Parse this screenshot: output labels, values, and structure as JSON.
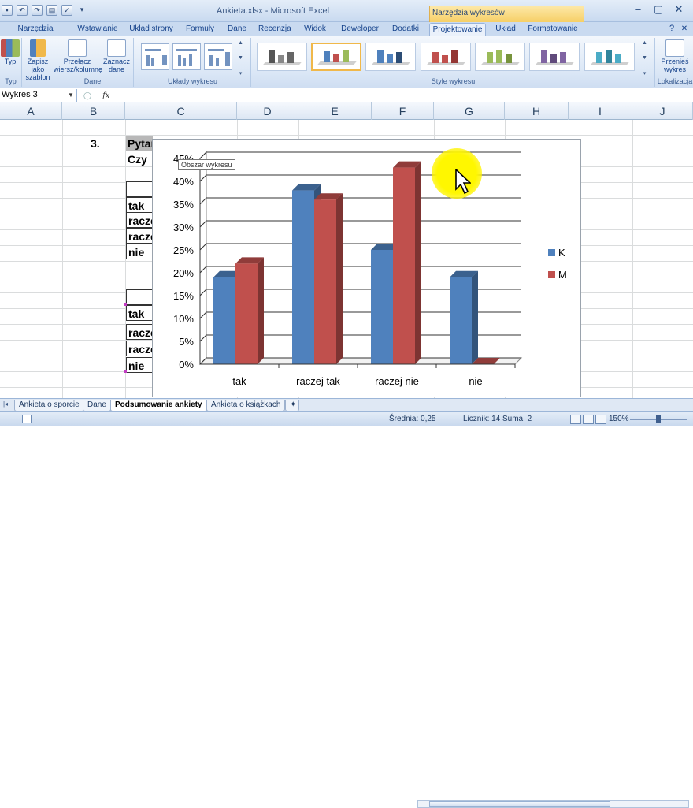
{
  "window": {
    "title": "Ankieta.xlsx - Microsoft Excel",
    "context_tools": "Narzędzia wykresów",
    "controls": [
      "–",
      "▢",
      "✕"
    ]
  },
  "ribbon_tabs": [
    "Narzędzia główne",
    "Wstawianie",
    "Układ strony",
    "Formuły",
    "Dane",
    "Recenzja",
    "Widok",
    "Deweloper",
    "Dodatki",
    "Projektowanie",
    "Układ",
    "Formatowanie"
  ],
  "ribbon": {
    "groups": {
      "typ": {
        "label": "Typ",
        "button": "Typ"
      },
      "dane": {
        "label": "Dane",
        "switch": "Przełącz wiersz/kolumnę",
        "select": "Zaznacz dane"
      },
      "save_template": "Zapisz jako szablon",
      "uklady": "Układy wykresu",
      "style": "Style wykresu",
      "lokalizacja": {
        "label": "Lokalizacja",
        "move": "Przenieś wykres"
      }
    }
  },
  "formula_bar": {
    "name_box": "Wykres 3",
    "fx": "fx",
    "content": ""
  },
  "columns": [
    "A",
    "B",
    "C",
    "D",
    "E",
    "F",
    "G",
    "H",
    "I",
    "J"
  ],
  "cells": {
    "question_no": "3.",
    "question_title": "Pytanie",
    "question_text": "Czy",
    "t1_rows": [
      "tak",
      "raczej tak",
      "raczej nie"
    ],
    "t1_last": "nie",
    "t2_rows": [
      "tak",
      "raczej tak",
      "raczej nie"
    ],
    "t2_last": "nie"
  },
  "chart_tooltip": "Obszar wykresu",
  "chart_data": {
    "type": "bar",
    "categories": [
      "tak",
      "raczej tak",
      "raczej nie",
      "nie"
    ],
    "series": [
      {
        "name": "K",
        "values": [
          0.19,
          0.38,
          0.25,
          0.19
        ],
        "color": "#4f81bd"
      },
      {
        "name": "M",
        "values": [
          0.22,
          0.36,
          0.43,
          0.0
        ],
        "color": "#c0504d"
      }
    ],
    "y_ticks": [
      "0%",
      "5%",
      "10%",
      "15%",
      "20%",
      "25%",
      "30%",
      "35%",
      "40%",
      "45%"
    ],
    "ylim": [
      0,
      0.45
    ],
    "grid": true,
    "legend": "right",
    "three_d": true
  },
  "sheet_tabs": [
    "Ankieta o sporcie",
    "Dane",
    "Podsumowanie ankiety",
    "Ankieta o książkach"
  ],
  "active_sheet": "Podsumowanie ankiety",
  "status": {
    "average": "Średnia: 0,25",
    "count": "Licznik: 14",
    "sum": "Suma: 2",
    "zoom": "150%"
  }
}
